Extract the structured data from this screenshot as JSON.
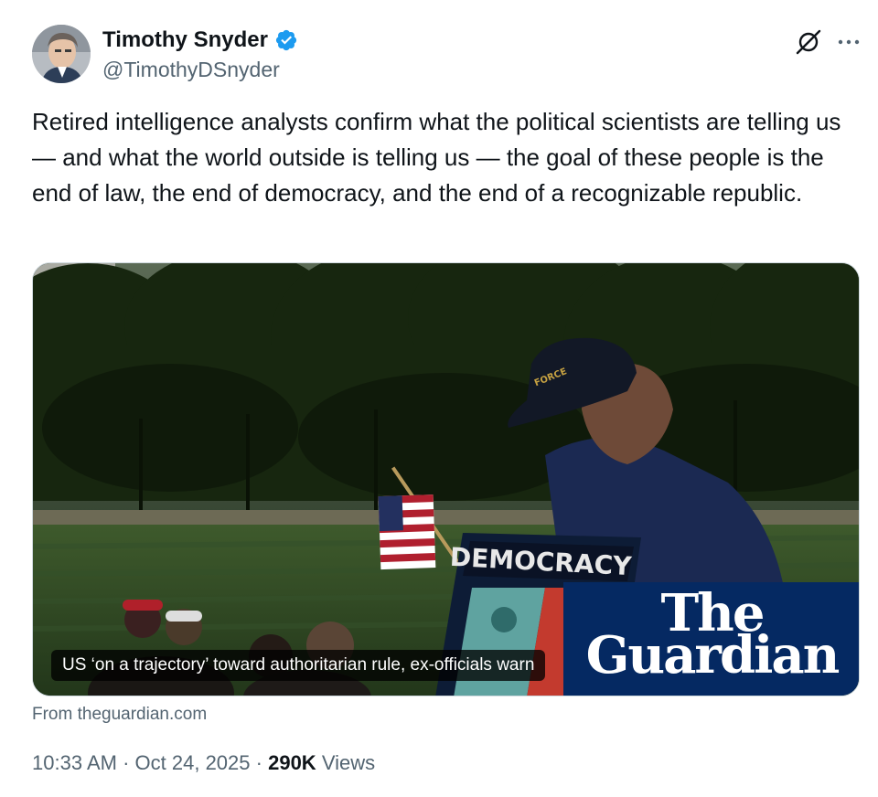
{
  "author": {
    "name": "Timothy Snyder",
    "handle": "@TimothyDSnyder",
    "verified": true,
    "verified_color": "#1d9bf0"
  },
  "header_icons": [
    "grok-icon",
    "more-icon"
  ],
  "post": {
    "text": "Retired intelligence analysts confirm what the political scientists are telling us — and what the world outside is telling us — the goal of these people is the end of law, the end of democracy, and the end of a recognizable republic."
  },
  "link_card": {
    "headline": "US ‘on a trajectory’ toward authoritarian rule, ex-officials warn",
    "source": "From theguardian.com",
    "brand": {
      "line1": "The",
      "line2": "Guardian",
      "color": "#052962"
    },
    "photo_sign_text": "DEMOCRACY"
  },
  "meta": {
    "time": "10:33 AM",
    "separator": "·",
    "date": "Oct 24, 2025",
    "views_count": "290K",
    "views_label": "Views"
  },
  "colors": {
    "text_primary": "#0f1419",
    "text_secondary": "#536471"
  }
}
